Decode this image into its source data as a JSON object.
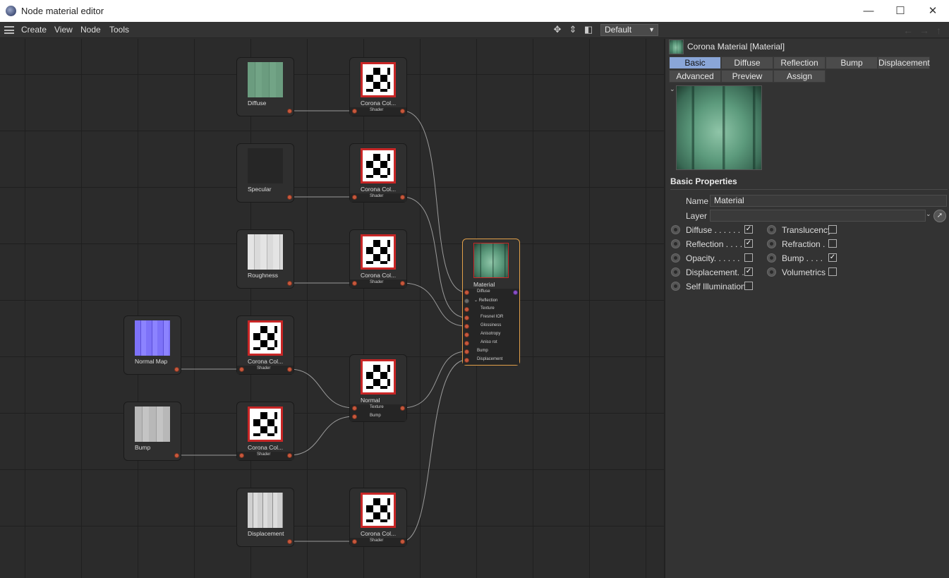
{
  "window": {
    "title": "Node material editor",
    "minimize": "—",
    "maximize": "☐",
    "close": "✕"
  },
  "menu": {
    "items": [
      "Create",
      "View",
      "Node",
      "Tools"
    ],
    "layout_value": "Default"
  },
  "nodes": {
    "diffuse_tex": {
      "label": "Diffuse"
    },
    "specular_tex": {
      "label": "Specular"
    },
    "roughness_tex": {
      "label": "Roughness"
    },
    "normalmap_tex": {
      "label": "Normal Map"
    },
    "bump_tex": {
      "label": "Bump"
    },
    "displacement_tex": {
      "label": "Displacement"
    },
    "cc_label": "Corona Col...",
    "shader_port": "Shader",
    "normal": {
      "label": "Normal",
      "ports": [
        "Texture",
        "Bump"
      ]
    },
    "material": {
      "label": "Material",
      "ports": [
        "Diffuse",
        "⌄ Reflection",
        "Texture",
        "Fresnel IOR",
        "Glossiness",
        "Anisotropy",
        "Aniso rot",
        "Bump",
        "Displacement"
      ]
    }
  },
  "panel": {
    "material_title": "Corona Material [Material]",
    "tabs_row1": [
      "Basic",
      "Diffuse",
      "Reflection",
      "Bump",
      "Displacement"
    ],
    "tabs_row2": [
      "Advanced",
      "Preview",
      "Assign"
    ],
    "active_tab": "Basic",
    "section_title": "Basic Properties",
    "name_label": "Name",
    "name_value": "Material",
    "layer_label": "Layer",
    "layer_value": "",
    "props_left": [
      {
        "label": "Diffuse . . . . . .",
        "checked": true
      },
      {
        "label": "Reflection . . . .",
        "checked": true
      },
      {
        "label": "Opacity. . . . . .",
        "checked": false
      },
      {
        "label": "Displacement. .",
        "checked": true
      },
      {
        "label": "Self Illumination",
        "checked": false
      }
    ],
    "props_right": [
      {
        "label": "Translucency",
        "checked": false
      },
      {
        "label": "Refraction .",
        "checked": false
      },
      {
        "label": "Bump . . . .",
        "checked": true
      },
      {
        "label": "Volumetrics",
        "checked": false
      }
    ]
  },
  "colors": {
    "accent_tab": "#8aa6d8",
    "port": "#c8583c",
    "material_border": "#e1a04a",
    "shader_red": "#c82626"
  }
}
